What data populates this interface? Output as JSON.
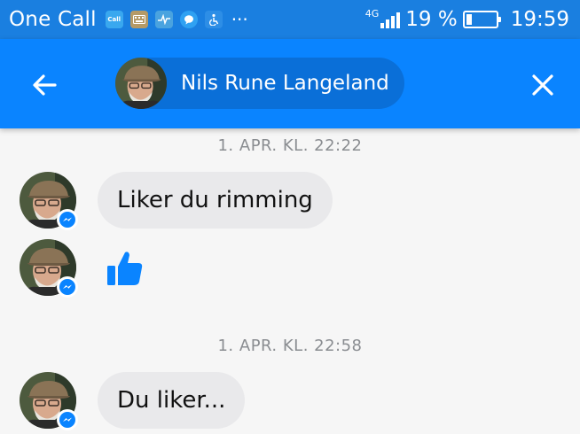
{
  "status_bar": {
    "carrier": "One Call",
    "notification_icons": [
      {
        "icon": "one-call-app-icon",
        "label": "Call",
        "color": "#39a8ef"
      },
      {
        "icon": "keyboard-icon",
        "label": "",
        "color": "#b59a66"
      },
      {
        "icon": "health-icon",
        "label": "",
        "color": "#4aa3df"
      },
      {
        "icon": "messenger-bubble-icon",
        "label": "",
        "color": "#2fa1f2"
      },
      {
        "icon": "accessibility-icon",
        "label": "",
        "color": "#2d8ee6"
      }
    ],
    "overflow": "···",
    "network": "4G",
    "battery_percent": "19 %",
    "battery_level": 0.19,
    "time": "19:59"
  },
  "header": {
    "back_icon": "back-arrow-icon",
    "contact_name": "Nils Rune Langeland",
    "close_icon": "close-icon",
    "bar_color": "#0a84ff"
  },
  "conversation": {
    "groups": [
      {
        "timestamp": "1. APR. KL. 22:22",
        "messages": [
          {
            "type": "text",
            "text": "Liker du rimming"
          },
          {
            "type": "like",
            "icon": "thumbs-up-icon"
          }
        ]
      },
      {
        "timestamp": "1. APR. KL. 22:58",
        "messages": [
          {
            "type": "text",
            "text": "Du liker..."
          }
        ]
      }
    ],
    "bubble_color": "#e9e9eb",
    "badge_icon": "messenger-badge-icon"
  }
}
